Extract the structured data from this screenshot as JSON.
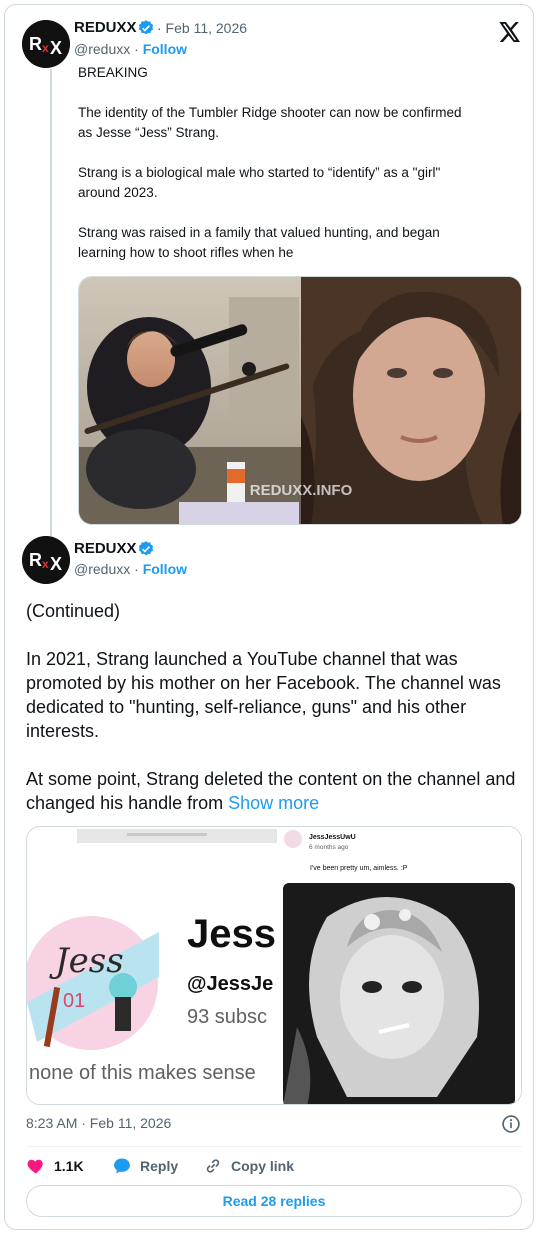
{
  "quoted": {
    "name": "REDUXX",
    "date": "· Feb 11, 2026",
    "handle": "@reduxx",
    "follow": "Follow",
    "lines": [
      "BREAKING",
      "The identity of the Tumbler Ridge shooter can now be confirmed",
      "as Jesse “Jess” Strang.",
      "Strang is a biological male who started to “identify” as a \"girl\"",
      "around 2023.",
      "Strang was raised in a family that valued hunting, and began",
      "learning how to shoot rifles when he"
    ],
    "watermark": "REDUXX.INFO"
  },
  "post": {
    "name": "REDUXX",
    "handle": "@reduxx",
    "follow": "Follow",
    "paragraphs": [
      "(Continued)",
      "In 2021, Strang launched a YouTube channel that was promoted by his mother on her Facebook. The channel was dedicated to \"hunting, self-reliance, guns\" and his other interests.",
      "At some point, Strang deleted the content on the channel and changed his handle from "
    ],
    "show_more": "Show more",
    "image": {
      "channel_logo": "Jess",
      "channel_logo_num": "01",
      "channel_name": "Jess",
      "channel_handle": "@JessJe",
      "subs": "93 subsc",
      "caption": "none of this makes sense",
      "post_user": "JessJessUwU",
      "post_time": "6 months ago",
      "post_text": "I've been pretty um, aimless. :P"
    },
    "timestamp": "8:23 AM · Feb 11, 2026",
    "likes": "1.1K",
    "reply": "Reply",
    "copy_link": "Copy link",
    "read_replies": "Read 28 replies"
  },
  "colors": {
    "accent": "#1d9bf0",
    "like": "#f91880",
    "muted": "#536471"
  },
  "icons": [
    "x-logo-icon",
    "verified-badge-icon",
    "heart-icon",
    "reply-icon",
    "link-icon",
    "info-icon"
  ]
}
